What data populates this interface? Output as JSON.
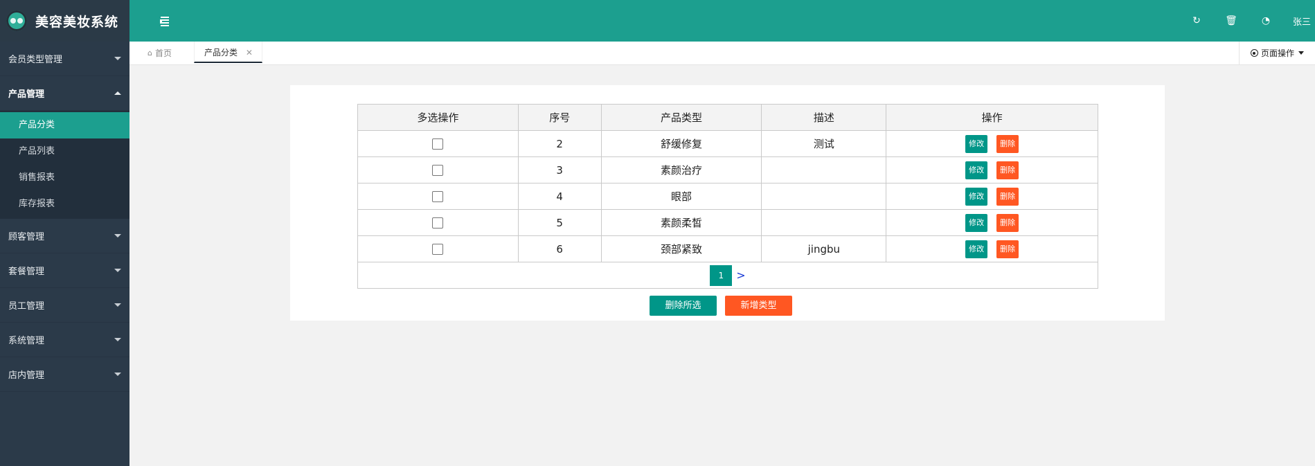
{
  "app": {
    "title": "美容美妆系统",
    "user": "张三"
  },
  "header": {
    "icons": [
      "refresh-icon",
      "trash-icon",
      "dashboard-icon"
    ]
  },
  "sidebar": {
    "groups": [
      {
        "label": "会员类型管理",
        "open": false
      },
      {
        "label": "产品管理",
        "open": true,
        "items": [
          {
            "label": "产品分类",
            "active": true
          },
          {
            "label": "产品列表"
          },
          {
            "label": "销售报表"
          },
          {
            "label": "库存报表"
          }
        ]
      },
      {
        "label": "顾客管理",
        "open": false
      },
      {
        "label": "套餐管理",
        "open": false
      },
      {
        "label": "员工管理",
        "open": false
      },
      {
        "label": "系统管理",
        "open": false
      },
      {
        "label": "店内管理",
        "open": false
      }
    ]
  },
  "tabs": {
    "home_label": "首页",
    "active_label": "产品分类",
    "page_ops_label": "页面操作"
  },
  "table": {
    "headers": [
      "多选操作",
      "序号",
      "产品类型",
      "描述",
      "操作"
    ],
    "rows": [
      {
        "id": "2",
        "type": "舒缓修复",
        "desc": "测试"
      },
      {
        "id": "3",
        "type": "素颜治疗",
        "desc": ""
      },
      {
        "id": "4",
        "type": "眼部",
        "desc": ""
      },
      {
        "id": "5",
        "type": "素颜柔皙",
        "desc": ""
      },
      {
        "id": "6",
        "type": "颈部紧致",
        "desc": "jingbu"
      }
    ],
    "edit_label": "修改",
    "delete_label": "删除"
  },
  "pager": {
    "current": "1",
    "next": ">"
  },
  "actions": {
    "delete_selected": "删除所选",
    "add_type": "新增类型"
  },
  "colors": {
    "primary": "#009688",
    "danger": "#ff5722",
    "header": "#1c9f8f",
    "sidebar": "#2b3a49"
  }
}
